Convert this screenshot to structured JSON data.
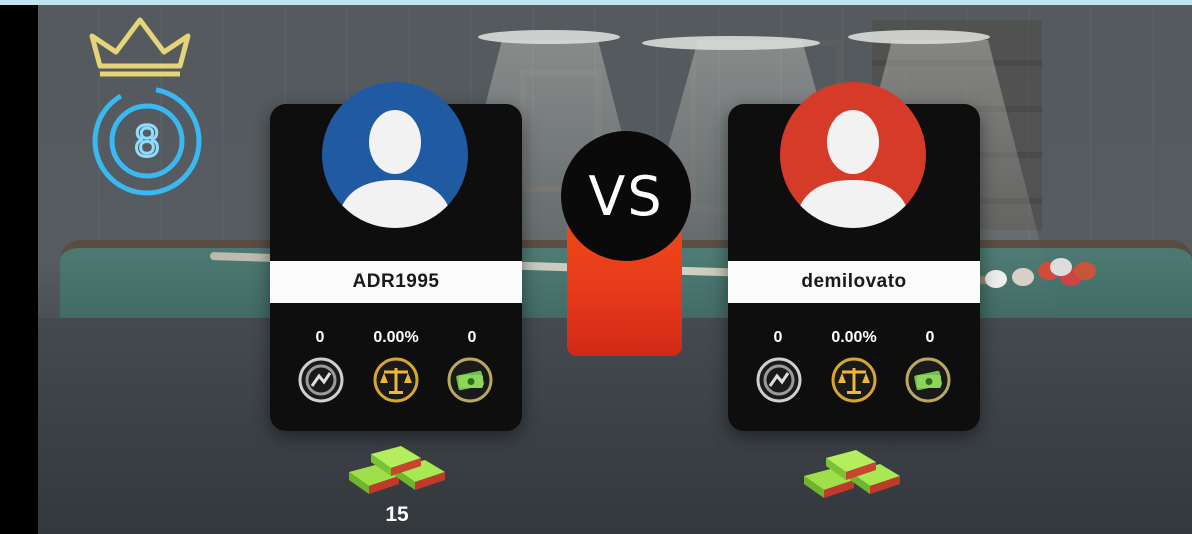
{
  "vs_label": "VS",
  "player1": {
    "name": "ADR1995",
    "avatar_color": "#1f5aa3",
    "stats": {
      "wins": "0",
      "win_rate": "0.00%",
      "earnings": "0"
    },
    "cash_amount": "15"
  },
  "player2": {
    "name": "demilovato",
    "avatar_color": "#d63b2a",
    "stats": {
      "wins": "0",
      "win_rate": "0.00%",
      "earnings": "0"
    },
    "cash_amount": ""
  },
  "icons": {
    "logo": "eight-ball-neon-logo",
    "crown": "crown-icon",
    "wins": "trophy-badge-icon",
    "win_rate": "balance-scale-icon",
    "earnings": "cash-icon",
    "stake": "cash-stack-icon"
  },
  "colors": {
    "accent_red": "#e4371a",
    "card_bg": "#0e0e0e",
    "neon_blue": "#39b8f2",
    "neon_yellow": "#e6d47a"
  }
}
